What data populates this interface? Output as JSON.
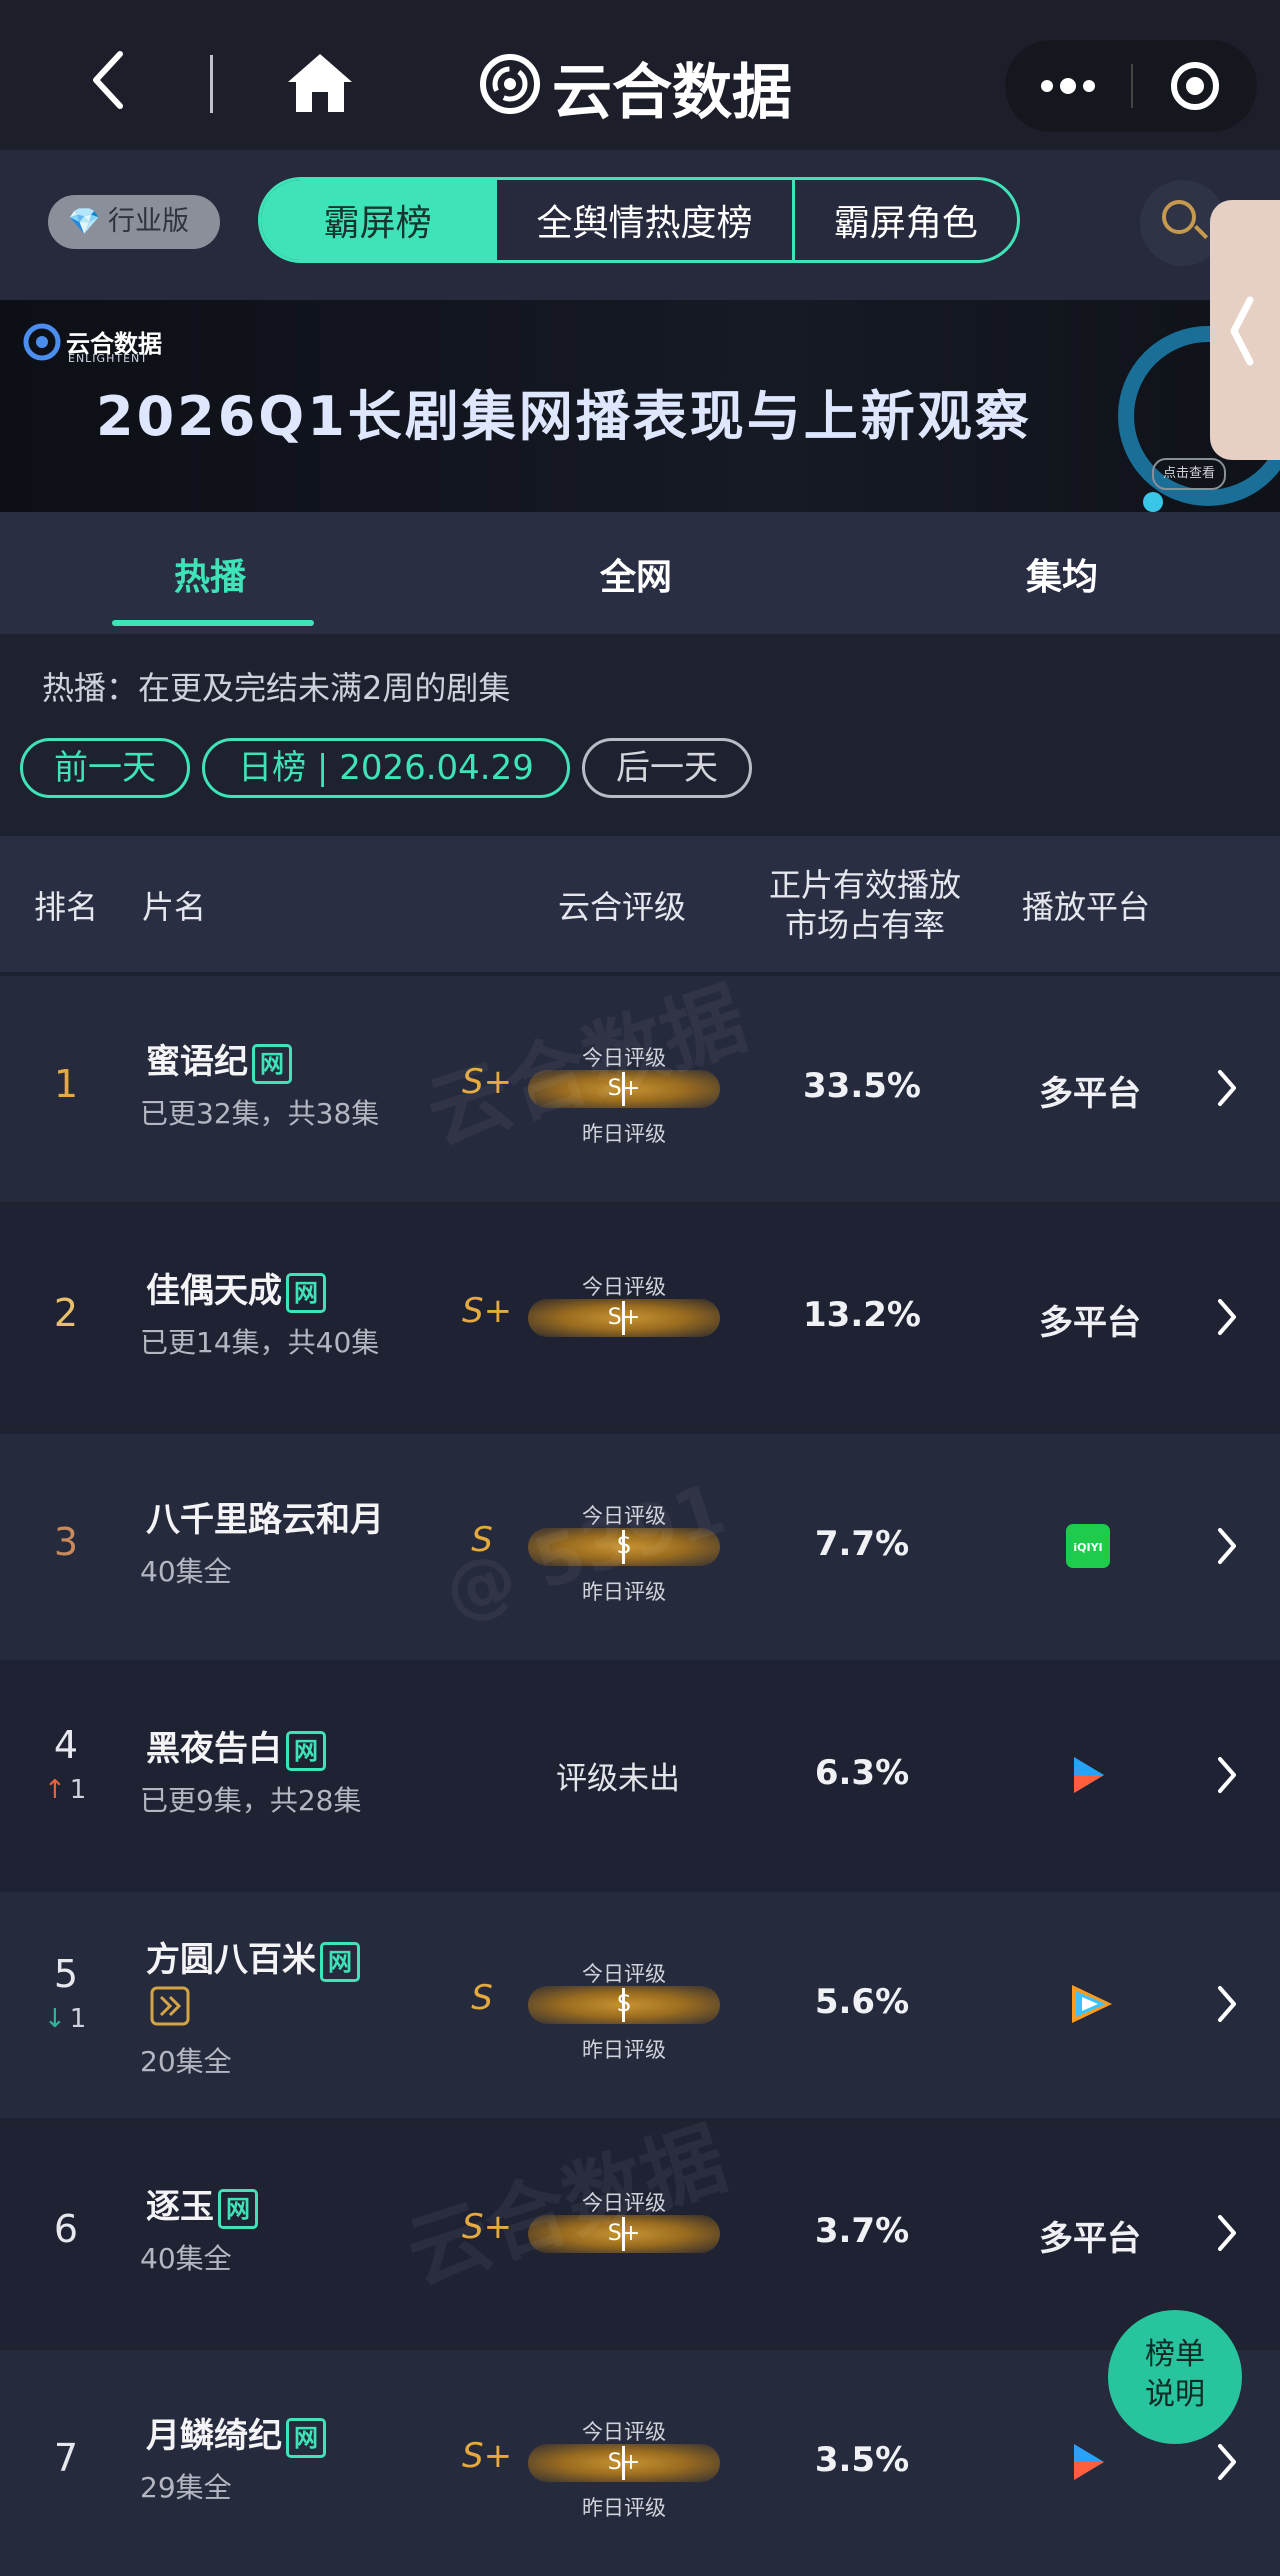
{
  "topbar": {
    "back_icon": "chevron-left-icon",
    "home_icon": "home-icon",
    "title": "云合数据",
    "more_icon": "more-dots-icon",
    "close_icon": "target-circle-icon"
  },
  "subbar": {
    "industry_label": "行业版",
    "tabs": [
      "霸屏榜",
      "全舆情热度榜",
      "霸屏角色"
    ],
    "active_tab": 0,
    "search_icon": "search-icon"
  },
  "banner": {
    "logo_text": "云合数据",
    "logo_sub": "ENLIGHTENT",
    "title": "2026Q1长剧集网播表现与上新观察",
    "cta": "点击查看"
  },
  "main_tabs": [
    "热播",
    "全网",
    "集均"
  ],
  "description": "热播：在更及完结未满2周的剧集",
  "date_nav": {
    "prev": "前一天",
    "current": "日榜 | 2026.04.29",
    "next": "后一天"
  },
  "table": {
    "headers": {
      "rank": "排名",
      "name": "片名",
      "grade": "云合评级",
      "share_line1": "正片有效播放",
      "share_line2": "市场占有率",
      "platform": "播放平台"
    },
    "grade_today_label": "今日评级",
    "grade_yesterday_label": "昨日评级",
    "rows": [
      {
        "rank": "1",
        "name": "蜜语纪",
        "badge": "网",
        "sub": "已更32集，共38集",
        "grade": "S+",
        "grade_bar": "S+",
        "show_yesterday": true,
        "share": "33.5%",
        "platform": "多平台",
        "platform_icon": ""
      },
      {
        "rank": "2",
        "name": "佳偶天成",
        "badge": "网",
        "sub": "已更14集，共40集",
        "grade": "S+",
        "grade_bar": "S+",
        "show_yesterday": false,
        "share": "13.2%",
        "platform": "多平台",
        "platform_icon": ""
      },
      {
        "rank": "3",
        "name": "八千里路云和月",
        "badge": "",
        "sub": "40集全",
        "grade": "S",
        "grade_bar": "S",
        "show_yesterday": true,
        "share": "7.7%",
        "platform": "",
        "platform_icon": "iqiyi-icon"
      },
      {
        "rank": "4",
        "name": "黑夜告白",
        "badge": "网",
        "sub": "已更9集，共28集",
        "grade": "",
        "grade_pending": "评级未出",
        "show_yesterday": false,
        "share": "6.3%",
        "platform": "",
        "platform_icon": "youku-icon",
        "delta": "1",
        "delta_dir": "up"
      },
      {
        "rank": "5",
        "name": "方圆八百米",
        "badge": "网",
        "badge2": "⊳",
        "sub": "20集全",
        "grade": "S",
        "grade_bar": "S",
        "show_yesterday": true,
        "share": "5.6%",
        "platform": "",
        "platform_icon": "tencent-video-icon",
        "delta": "1",
        "delta_dir": "down"
      },
      {
        "rank": "6",
        "name": "逐玉",
        "badge": "网",
        "sub": "40集全",
        "grade": "S+",
        "grade_bar": "S+",
        "show_yesterday": false,
        "share": "3.7%",
        "platform": "多平台",
        "platform_icon": ""
      },
      {
        "rank": "7",
        "name": "月鳞绮纪",
        "badge": "网",
        "sub": "29集全",
        "grade": "S+",
        "grade_bar": "S+",
        "show_yesterday": true,
        "share": "3.5%",
        "platform": "",
        "platform_icon": "youku-icon"
      }
    ]
  },
  "explain_button": {
    "line1": "榜单",
    "line2": "说明"
  },
  "watermarks": [
    "云合数据",
    "ENLIGHTENT",
    "@ 5391"
  ],
  "colors": {
    "accent": "#3fe3b8",
    "gold": "#e5a93e",
    "up": "#e8633a",
    "down": "#2fb39a"
  }
}
